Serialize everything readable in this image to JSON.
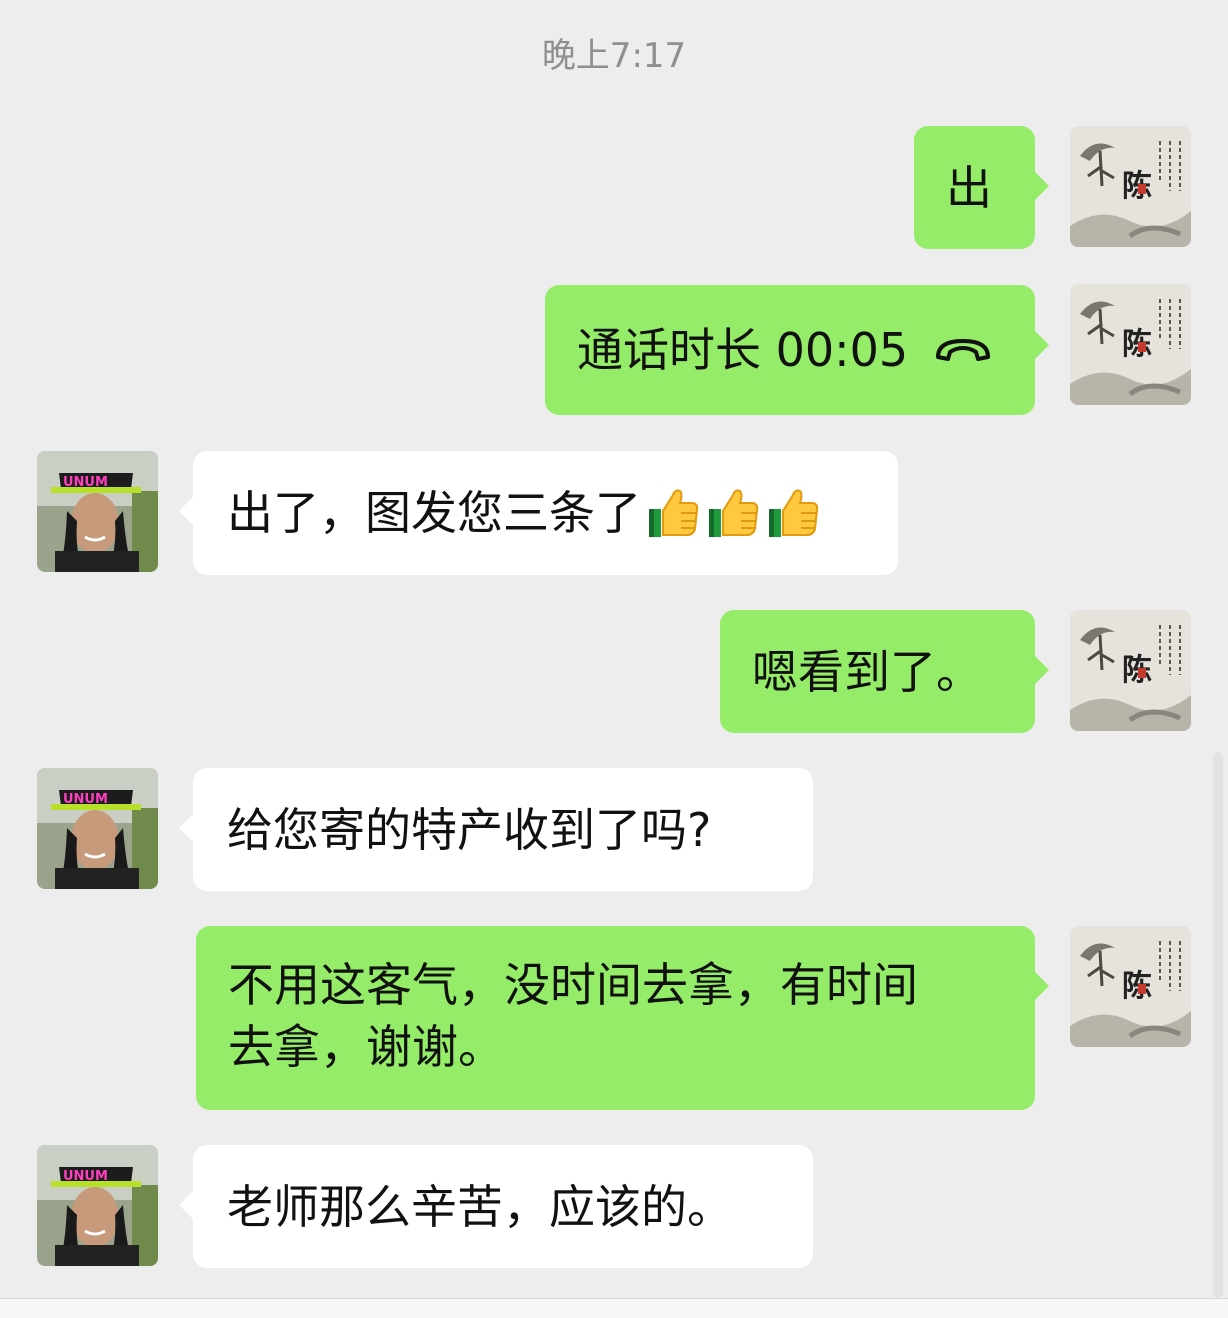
{
  "timestamp": "晚上7:17",
  "messages": [
    {
      "id": "m1",
      "side": "sent",
      "text": "出"
    },
    {
      "id": "m2",
      "side": "sent",
      "type": "call",
      "text": "通话时长 00:05",
      "icon": "phone-hangup-icon"
    },
    {
      "id": "m3",
      "side": "received",
      "text": "出了，图发您三条了",
      "emoji": [
        "thumbs-up-icon",
        "thumbs-up-icon",
        "thumbs-up-icon"
      ]
    },
    {
      "id": "m4",
      "side": "sent",
      "text": "嗯看到了。"
    },
    {
      "id": "m5",
      "side": "received",
      "text": "给您寄的特产收到了吗?"
    },
    {
      "id": "m6",
      "side": "sent",
      "lines": [
        "不用这客气，没时间去拿，有时间",
        "去拿，谢谢。"
      ]
    },
    {
      "id": "m7",
      "side": "received",
      "text": "老师那么辛苦，应该的。"
    }
  ],
  "avatars": {
    "self": {
      "kind": "ink-painting-avatar",
      "text": "陈"
    },
    "contact": {
      "kind": "photo-avatar",
      "hat_text": "UNUM"
    }
  },
  "colors": {
    "background": "#ededed",
    "sent_bubble": "#95ec69",
    "received_bubble": "#ffffff",
    "timestamp_text": "#8f8f8f"
  }
}
